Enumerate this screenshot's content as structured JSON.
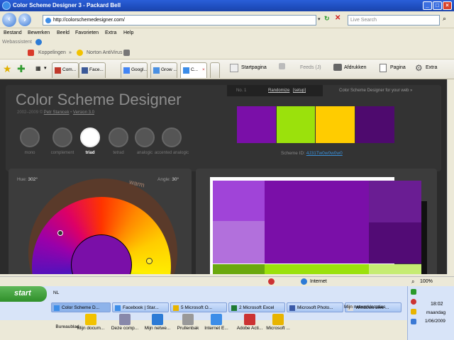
{
  "window": {
    "title": "Color Scheme Designer 3 - Packard Bell"
  },
  "address": {
    "url": "http://colorschemedesigner.com/",
    "search_placeholder": "Live Search"
  },
  "menu": [
    "Bestand",
    "Bewerken",
    "Beeld",
    "Favorieten",
    "Extra",
    "Help"
  ],
  "webassistent": "Webassistent",
  "links": {
    "label": "Koppelingen",
    "norton": "Norton AntiVirus"
  },
  "tabs": [
    {
      "label": "Com...",
      "color": "#C0392B"
    },
    {
      "label": "Face...",
      "color": "#3B5998"
    },
    {
      "label": "Googl...",
      "color": "#4285F4"
    },
    {
      "label": "Grow ...",
      "color": "#4A90E2"
    },
    {
      "label": "C...",
      "color": "#3C8DE8"
    }
  ],
  "toolbar": {
    "startpagina": "Startpagina",
    "feeds": "Feeds (J)",
    "afdrukken": "Afdrukken",
    "pagina": "Pagina",
    "extra": "Extra"
  },
  "app": {
    "logo": "Color Scheme Designer",
    "credit_year": "2002–2009 © ",
    "credit_author": "Petr Stanicek",
    "credit_sep": " • ",
    "credit_version": "Version 3.0",
    "modes": [
      {
        "label": "mono",
        "active": false
      },
      {
        "label": "complement",
        "active": false
      },
      {
        "label": "triad",
        "active": true
      },
      {
        "label": "tetrad",
        "active": false
      },
      {
        "label": "analogic",
        "active": false
      },
      {
        "label": "accented analogic",
        "active": false
      }
    ],
    "tab_no": "No. 1",
    "randomize": "Randomize",
    "setup": "[setup]",
    "site_link": "Color Scheme Designer for your web »",
    "scheme_colors": [
      "#7A0FA8",
      "#9BE10C",
      "#FFCC00",
      "#4E0A6E"
    ],
    "scheme_id_label": "Scheme ID:",
    "scheme_id_value": "4J31Tw0w0w0w0",
    "hue_label": "Hue:",
    "hue_value": "302°",
    "angle_label": "Angle:",
    "angle_value": "30°",
    "warm_label": "warm"
  },
  "status": {
    "zone": "Internet",
    "zoom": "100%"
  },
  "taskbar": {
    "start": "start",
    "lang": "NL",
    "tasks": [
      {
        "label": "Color Scheme D...",
        "active": true
      },
      {
        "label": "Facebook | Star...",
        "active": false
      },
      {
        "label": "5 Microsoft O...",
        "active": false
      },
      {
        "label": "2 Microsoft Excel",
        "active": false
      },
      {
        "label": "Microsoft Photo...",
        "active": false
      },
      {
        "label": "Windows Live ...",
        "active": false
      }
    ],
    "quicklaunch": [
      "Bureaublad",
      "Mijn docum...",
      "Deze comp...",
      "Mijn netwe...",
      "Prullenbak",
      "Internet E...",
      "Adobe Acti...",
      "Microsoft ..."
    ],
    "netloc": "Mijn netwerklocaties",
    "clock": {
      "time": "18:02",
      "day": "maandag",
      "date": "1/06/2009"
    }
  }
}
